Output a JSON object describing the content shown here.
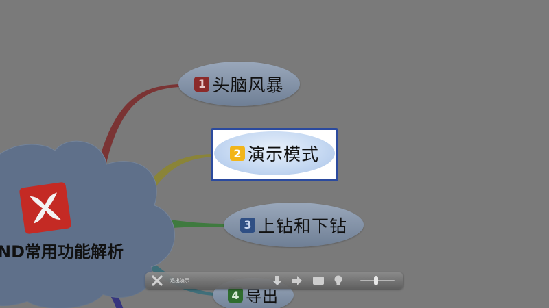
{
  "central_topic": {
    "title": "ND常用功能解析"
  },
  "topics": [
    {
      "number": "1",
      "label": "头脑风暴"
    },
    {
      "number": "2",
      "label": "演示模式"
    },
    {
      "number": "3",
      "label": "上钻和下钻"
    },
    {
      "number": "4",
      "label": "导出"
    }
  ],
  "toolbar": {
    "exit_label": "退出演示",
    "zoom_level": 0.45
  },
  "icons": {
    "exit": "x-icon",
    "down": "arrow-down-icon",
    "right": "arrow-right-icon",
    "stop": "square-icon",
    "hint": "lightbulb-icon"
  },
  "colors": {
    "background": "#7a7a7a",
    "branch_1": "#7a3434",
    "branch_2": "#8a8438",
    "branch_3": "#3f7a3f",
    "branch_4": "#3f6f7a",
    "branch_5": "#35357e",
    "selected_border": "#2b4a9e",
    "badge_2": "#f2b51a",
    "logo_red": "#c42a24"
  }
}
